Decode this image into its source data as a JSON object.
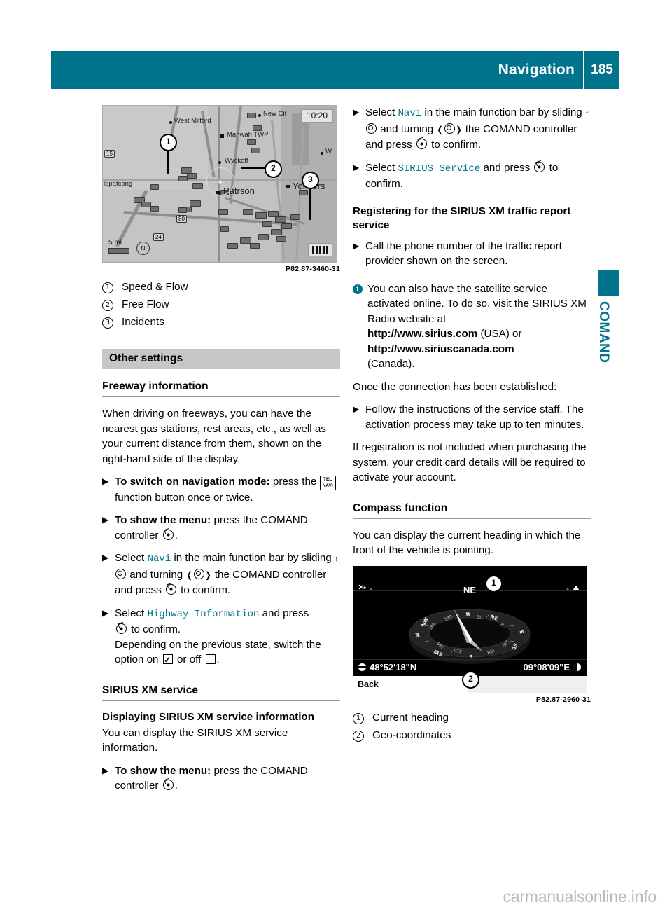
{
  "header": {
    "title": "Navigation",
    "page_number": "185"
  },
  "side_tab": {
    "label": "COMAND"
  },
  "left_column": {
    "map_figure": {
      "code": "P82.87-3460-31",
      "clock": "10:20",
      "scale": "5 mi",
      "compass_letter": "N",
      "labels": [
        "West Milford",
        "New Cit",
        "Mahwah TWP",
        "Wyckoff",
        "lopatcong",
        "Patrson",
        "Yonkers",
        "W"
      ],
      "shields": [
        "15",
        "80",
        "24"
      ],
      "callouts": [
        "1",
        "2",
        "3"
      ]
    },
    "legend": [
      {
        "num": "1",
        "label": "Speed & Flow"
      },
      {
        "num": "2",
        "label": "Free Flow"
      },
      {
        "num": "3",
        "label": "Incidents"
      }
    ],
    "other_settings_heading": "Other settings",
    "freeway_heading": "Freeway information",
    "freeway_intro": "When driving on freeways, you can have the nearest gas stations, rest areas, etc., as well as your current distance from them, shown on the right-hand side of the display.",
    "step_switch_on_bold": "To switch on navigation mode:",
    "step_switch_on_rest_a": "press the",
    "fn_button_line1": "TEL",
    "fn_button_line2": "NAVI",
    "step_switch_on_rest_b": "function button once or twice.",
    "step_show_menu_bold": "To show the menu:",
    "step_show_menu_rest": "press the COMAND controller",
    "step_select_navi_a": "Select",
    "step_select_navi_code": "Navi",
    "step_select_navi_b": "in the main function bar by sliding",
    "step_select_navi_c": "and turning",
    "step_select_navi_d": "the COMAND controller and press",
    "step_select_navi_e": "to confirm.",
    "step_select_highway_a": "Select",
    "step_select_highway_code": "Highway Information",
    "step_select_highway_b": "and press",
    "step_select_highway_c": "to confirm.",
    "step_select_highway_note_a": "Depending on the previous state, switch the option on",
    "step_select_highway_note_b": "or off",
    "step_select_highway_note_c": ".",
    "sirius_heading": "SIRIUS XM service",
    "displaying_heading": "Displaying SIRIUS XM service information",
    "displaying_text": "You can display the SIRIUS XM service information.",
    "step_show_menu2_bold": "To show the menu:",
    "step_show_menu2_rest": "press the COMAND controller"
  },
  "right_column": {
    "step_select_navi_a": "Select",
    "step_select_navi_code": "Navi",
    "step_select_navi_b": "in the main function bar by sliding",
    "step_select_navi_c": "and turning",
    "step_select_navi_d": "the COMAND controller and press",
    "step_select_navi_e": "to confirm.",
    "step_select_sirius_a": "Select",
    "step_select_sirius_code": "SIRIUS Service",
    "step_select_sirius_b": "and press",
    "step_select_sirius_c": "to confirm.",
    "registering_heading": "Registering for the SIRIUS XM traffic report service",
    "step_call": "Call the phone number of the traffic report provider shown on the screen.",
    "note_text_a": "You can also have the satellite service activated online. To do so, visit the SIRIUS XM Radio website at",
    "note_url_usa": "http://www.sirius.com",
    "note_usa_suffix": "(USA) or",
    "note_url_canada": "http://www.siriuscanada.com",
    "note_canada_suffix": "(Canada).",
    "once_connected": "Once the connection has been established:",
    "step_follow": "Follow the instructions of the service staff. The activation process may take up to ten minutes.",
    "registration_note": "If registration is not included when purchasing the system, your credit card details will be required to activate your account.",
    "compass_heading": "Compass function",
    "compass_intro": "You can display the current heading in which the front of the vehicle is pointing.",
    "compass_figure": {
      "code": "P82.87-2960-31",
      "heading": "NE",
      "left_indicator": "-",
      "right_indicator": "-",
      "latitude": "48°52'18\"N",
      "longitude": "09°08'09\"E",
      "back_label": "Back",
      "rose_marks": [
        "N",
        "NE",
        "E",
        "SE",
        "S",
        "SW",
        "W",
        "NW"
      ],
      "rose_degrees": [
        "30",
        "60",
        "120",
        "150",
        "210",
        "240",
        "300",
        "330"
      ],
      "callouts": [
        "1",
        "2"
      ]
    },
    "legend": [
      {
        "num": "1",
        "label": "Current heading"
      },
      {
        "num": "2",
        "label": "Geo-coordinates"
      }
    ]
  },
  "watermark": "carmanualsonline.info",
  "colors": {
    "brand_teal": "#00748c",
    "gray_heading_bg": "#c6c6c6"
  }
}
